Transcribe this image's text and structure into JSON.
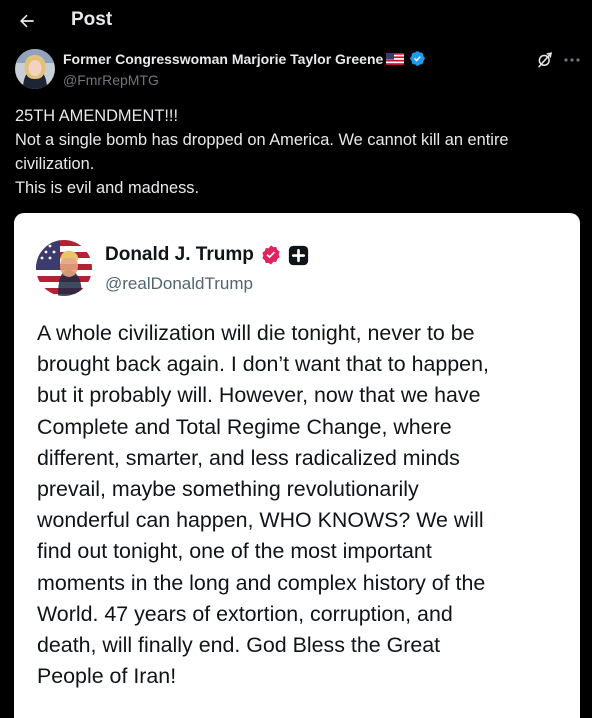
{
  "header": {
    "title": "Post"
  },
  "post": {
    "author_name": "Former Congresswoman Marjorie Taylor Greene",
    "author_handle": "@FmrRepMTG",
    "text_lines": [
      "25TH AMENDMENT!!!",
      "Not a single bomb has dropped on America. We cannot kill an entire",
      "civilization.",
      "This is evil and madness."
    ]
  },
  "embedded_post": {
    "author_name": "Donald J. Trump",
    "author_handle": "@realDonaldTrump",
    "text_lines": [
      "A whole civilization will die tonight, never to be",
      "brought back again. I don’t want that to happen,",
      "but it probably will. However, now that we have",
      "Complete and Total Regime Change, where",
      "different, smarter, and less radicalized minds",
      "prevail, maybe something revolutionarily",
      "wonderful can happen, WHO KNOWS? We will",
      "find out tonight, one of the most important",
      "moments in the long and complex history of the",
      "World. 47 years of extortion, corruption, and",
      "death, will finally end. God Bless the Great",
      "People of Iran!"
    ]
  },
  "colors": {
    "background": "#000000",
    "primary_text": "#e7e9ea",
    "secondary_text": "#71767b",
    "verified_blue": "#1d9bf0",
    "verified_pink": "#e0245e",
    "embed_background": "#ffffff"
  },
  "icons": {
    "back": "arrow-left-icon",
    "flag": "us-flag-icon",
    "verified": "verified-badge-icon",
    "grok": "grok-icon",
    "more": "more-icon",
    "plus": "plus-badge-icon"
  }
}
